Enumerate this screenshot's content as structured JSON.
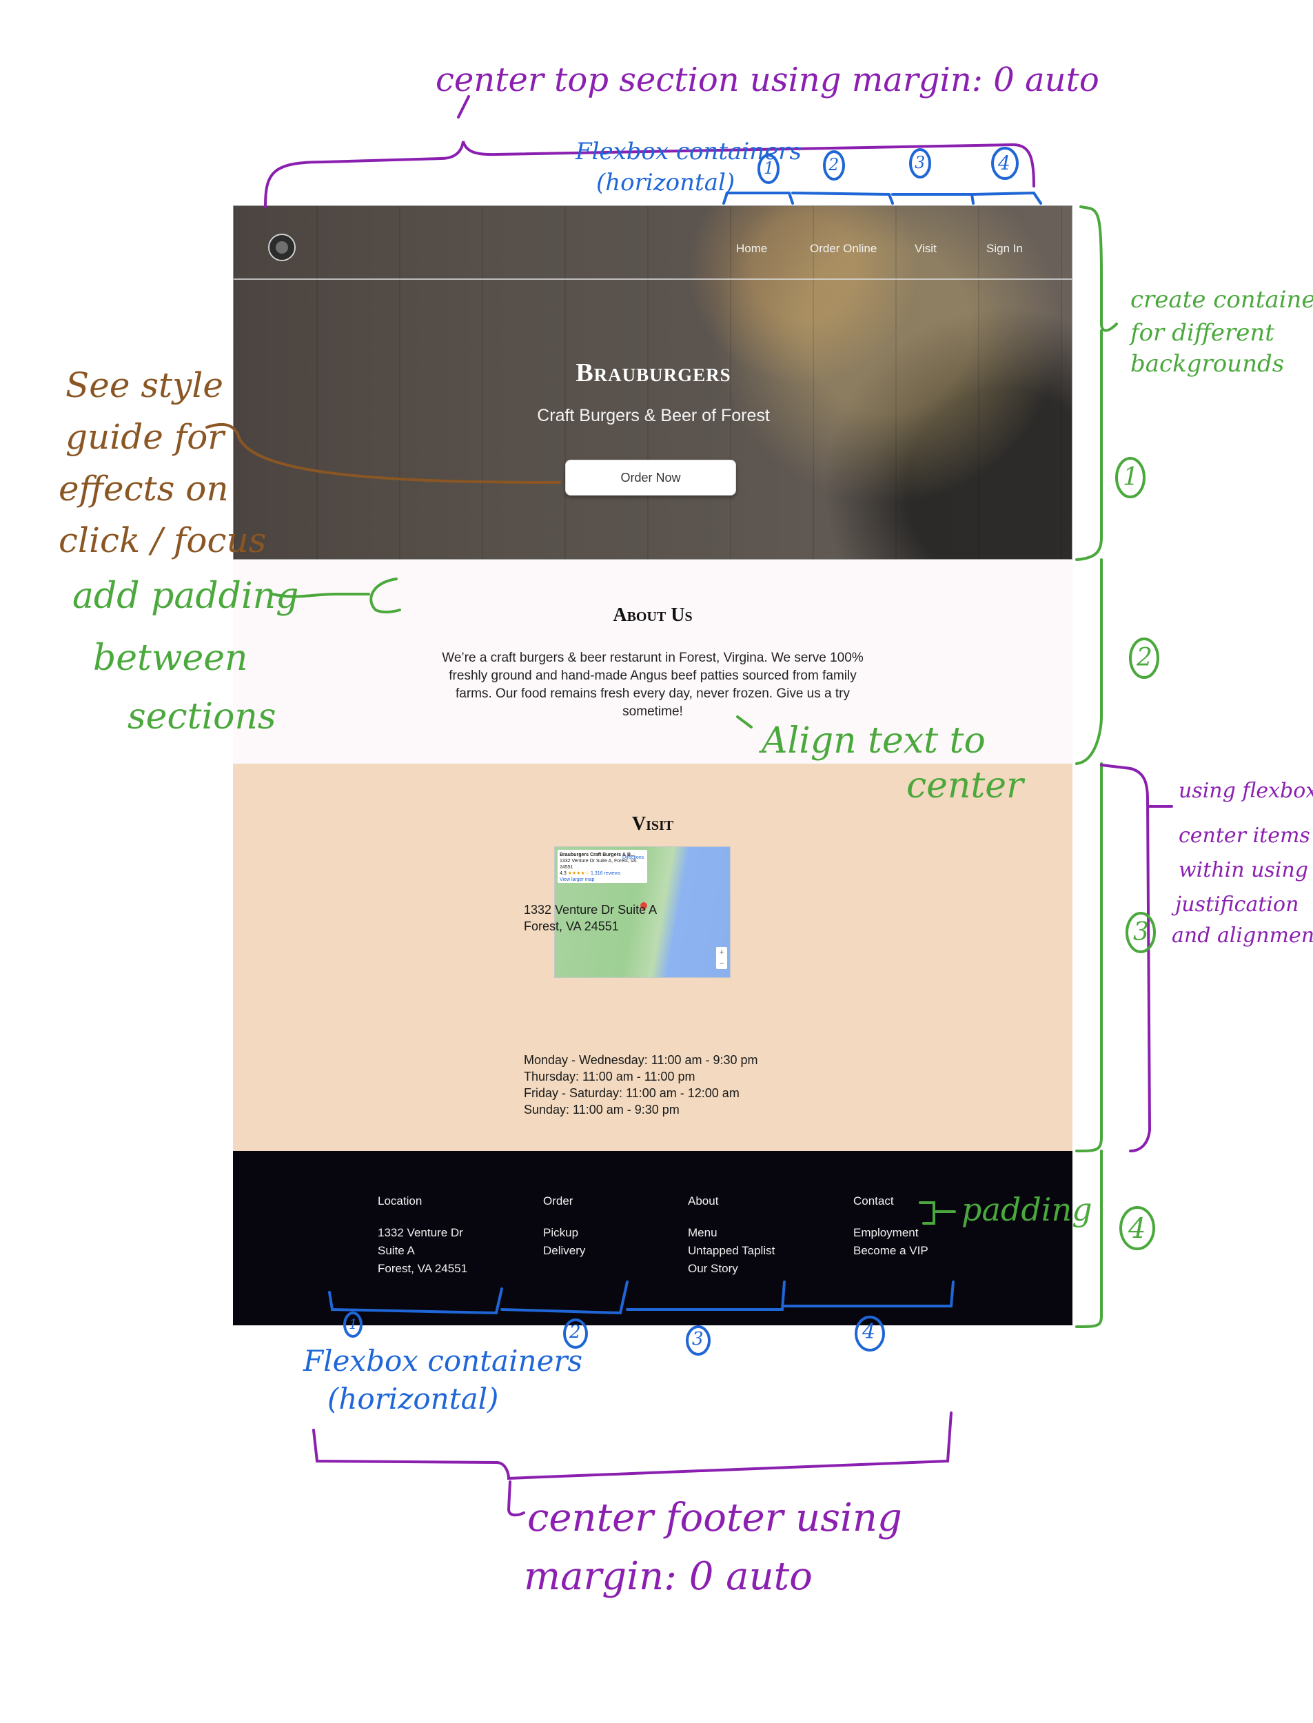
{
  "site": {
    "nav": {
      "home": "Home",
      "order_online": "Order Online",
      "visit": "Visit",
      "sign_in": "Sign In"
    },
    "hero": {
      "title": "Brauburgers",
      "subtitle": "Craft Burgers & Beer of Forest",
      "button": "Order Now"
    },
    "about": {
      "heading": "About Us",
      "text": "We’re a craft burgers & beer restarunt in Forest, Virgina. We serve 100% freshly ground and hand-made Angus beef patties sourced from family farms. Our food remains fresh every day, never frozen. Give us a try sometime!"
    },
    "visit": {
      "heading": "Visit",
      "map_card": {
        "name": "Brauburgers Craft Burgers & B...",
        "address": "1332 Venture Dr Suite A, Forest, VA 24551",
        "rating": "4.3",
        "reviews": "1,316 reviews",
        "link": "View larger map",
        "directions": "Directions"
      },
      "address_line1": "1332 Venture Dr Suite A",
      "address_line2": "Forest,  VA 24551",
      "hours": [
        "Monday - Wednesday: 11:00 am - 9:30 pm",
        "Thursday: 11:00 am - 11:00 pm",
        "Friday - Saturday: 11:00 am - 12:00 am",
        "Sunday: 11:00 am - 9:30 pm"
      ]
    },
    "footer": {
      "location": {
        "heading": "Location",
        "lines": [
          "1332 Venture Dr",
          "Suite A",
          "Forest,  VA 24551"
        ]
      },
      "order": {
        "heading": "Order",
        "lines": [
          "Pickup",
          "Delivery"
        ]
      },
      "about": {
        "heading": "About",
        "lines": [
          "Menu",
          "Untapped Taplist",
          "Our Story"
        ]
      },
      "contact": {
        "heading": "Contact",
        "lines": [
          "Employment",
          "Become a VIP"
        ]
      }
    }
  },
  "annotations": {
    "center_top": "center top section using margin: 0 auto",
    "flexbox_top_1": "Flexbox containers",
    "flexbox_top_2": "(horizontal)",
    "create_containers_1": "create containers",
    "create_containers_2": "for different",
    "create_containers_3": "backgrounds",
    "style_guide_1": "See style",
    "style_guide_2": "guide for",
    "style_guide_3": "effects on",
    "style_guide_4": "click / focus",
    "add_padding_1": "add padding",
    "add_padding_2": "between",
    "add_padding_3": "sections",
    "align_center_1": "Align text to",
    "align_center_2": "center",
    "flexbox_center_1": "using flexbox",
    "flexbox_center_2": "center items",
    "flexbox_center_3": "within using",
    "flexbox_center_4": "justification",
    "flexbox_center_5": "and alignment",
    "padding": "padding",
    "flexbox_bottom_1": "Flexbox containers",
    "flexbox_bottom_2": "(horizontal)",
    "center_footer_1": "center footer using",
    "center_footer_2": "margin: 0 auto",
    "section_numbers": [
      "1",
      "2",
      "3",
      "4"
    ],
    "flex_numbers": [
      "1",
      "2",
      "3",
      "4"
    ]
  },
  "colors": {
    "purple": "#8a1fb0",
    "green": "#4aa83c",
    "blue": "#1f66d6",
    "brown": "#8a5624",
    "about_bg": "#fdf9fb",
    "visit_bg": "#f2d9bf",
    "footer_bg": "#07060f"
  }
}
